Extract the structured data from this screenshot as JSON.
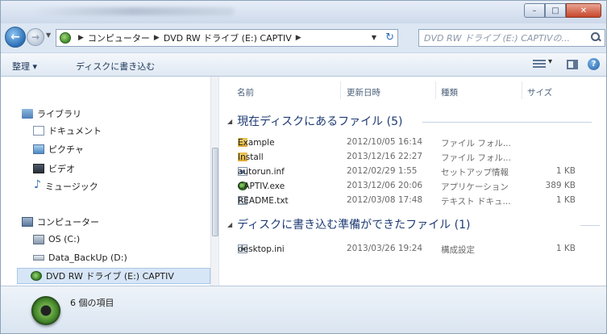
{
  "toolbar": {
    "organize": "整理 ▾",
    "burn": "ディスクに書き込む"
  },
  "address": {
    "crumbs": [
      "コンピューター",
      "DVD RW ドライブ (E:) CAPTIV"
    ],
    "search_placeholder": "DVD RW ドライブ (E:) CAPTIVの..."
  },
  "nav": {
    "libraries": "ライブラリ",
    "documents": "ドキュメント",
    "pictures": "ピクチャ",
    "videos": "ビデオ",
    "music": "ミュージック",
    "computer": "コンピューター",
    "os": "OS (C:)",
    "backup": "Data_BackUp (D:)",
    "dvd": "DVD RW ドライブ (E:) CAPTIV"
  },
  "columns": {
    "name": "名前",
    "date": "更新日時",
    "type": "種類",
    "size": "サイズ"
  },
  "groups": [
    {
      "title": "現在ディスクにあるファイル (5)",
      "files": [
        {
          "name": "Example",
          "date": "2012/10/05 16:14",
          "type": "ファイル フォル...",
          "size": "",
          "icon": "folder-icon"
        },
        {
          "name": "Install",
          "date": "2013/12/16 22:27",
          "type": "ファイル フォル...",
          "size": "",
          "icon": "folder-icon"
        },
        {
          "name": "autorun.inf",
          "date": "2012/02/29 1:55",
          "type": "セットアップ情報",
          "size": "1 KB",
          "icon": "setup-file-icon"
        },
        {
          "name": "CAPTIV.exe",
          "date": "2013/12/06 20:06",
          "type": "アプリケーション",
          "size": "389 KB",
          "icon": "app-icon"
        },
        {
          "name": "README.txt",
          "date": "2012/03/08 17:48",
          "type": "テキスト ドキュ...",
          "size": "1 KB",
          "icon": "text-file-icon"
        }
      ]
    },
    {
      "title": "ディスクに書き込む準備ができたファイル (1)",
      "files": [
        {
          "name": "desktop.ini",
          "date": "2013/03/26 19:24",
          "type": "構成設定",
          "size": "1 KB",
          "icon": "config-file-icon"
        }
      ]
    }
  ],
  "details": {
    "item_count": "6 個の項目"
  },
  "colors": {
    "chrome": "#dce7f3",
    "group_title": "#1e3b74",
    "selection": "#d7e6f7"
  }
}
